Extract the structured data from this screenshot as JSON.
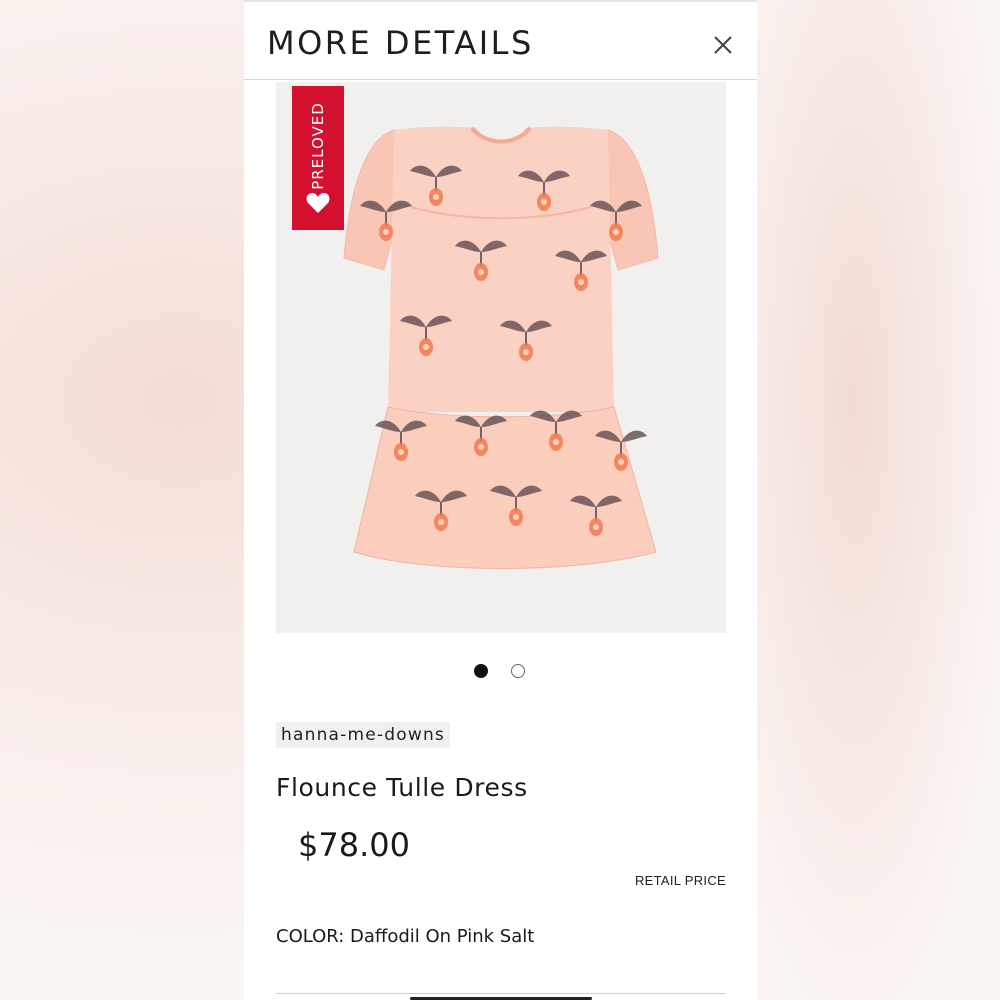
{
  "header": {
    "title": "MORE DETAILS",
    "close_icon": "close-icon"
  },
  "product": {
    "badge": {
      "label": "PRELOVED",
      "icon": "heart-icon",
      "color": "#d3112f"
    },
    "image": {
      "description_icon": "dress-image"
    },
    "carousel": {
      "total": 2,
      "active": 1
    },
    "brand": "hanna-me-downs",
    "name": "Flounce Tulle Dress",
    "price": "$78.00",
    "price_label": "RETAIL PRICE",
    "color_line": "COLOR: Daffodil On Pink Salt"
  },
  "colors": {
    "accent": "#d3112f",
    "dress_pink": "#f8c8b8",
    "leaf": "#6a5358",
    "flower": "#f07a50"
  }
}
